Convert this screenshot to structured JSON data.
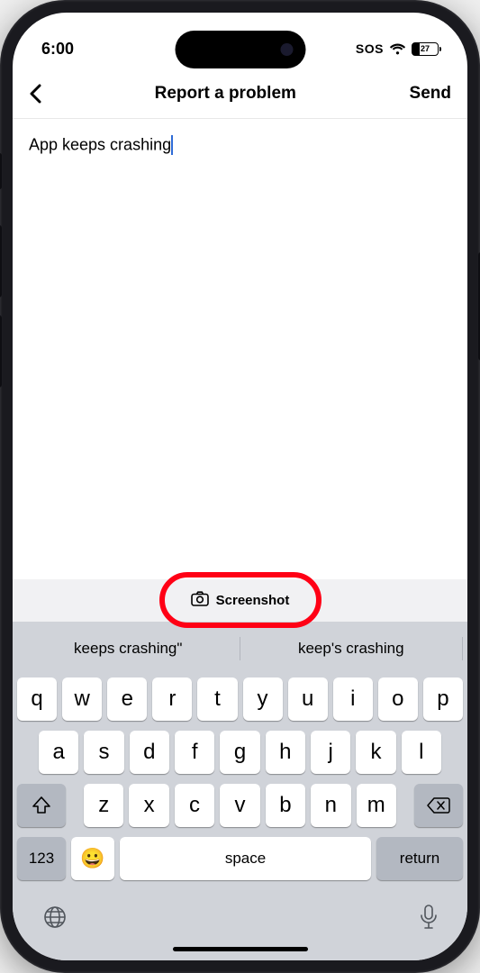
{
  "status": {
    "time": "6:00",
    "sos": "SOS",
    "battery_pct": "27"
  },
  "nav": {
    "title": "Report a problem",
    "send": "Send"
  },
  "content": {
    "input_text": "App keeps crashing"
  },
  "screenshot": {
    "label": "Screenshot"
  },
  "keyboard": {
    "suggestions": [
      "keeps crashing\"",
      "keep's crashing"
    ],
    "row1": [
      "q",
      "w",
      "e",
      "r",
      "t",
      "y",
      "u",
      "i",
      "o",
      "p"
    ],
    "row2": [
      "a",
      "s",
      "d",
      "f",
      "g",
      "h",
      "j",
      "k",
      "l"
    ],
    "row3": [
      "z",
      "x",
      "c",
      "v",
      "b",
      "n",
      "m"
    ],
    "key_123": "123",
    "key_space": "space",
    "key_return": "return"
  }
}
